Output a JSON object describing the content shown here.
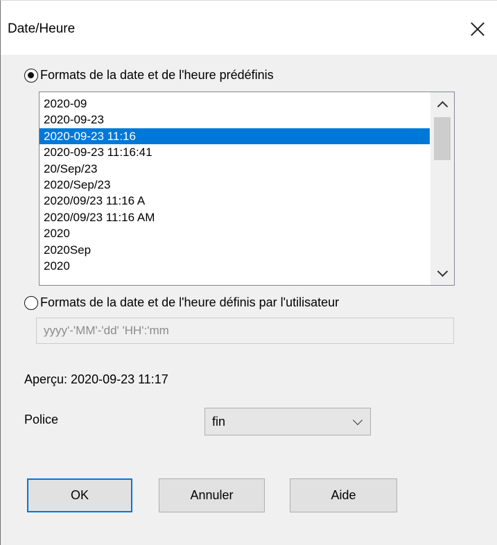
{
  "window": {
    "title": "Date/Heure",
    "close_icon": "close-icon"
  },
  "predefined": {
    "label": "Formats de la date et de l'heure prédéfinis",
    "checked": true,
    "items": [
      "2020-09",
      "2020-09-23",
      "2020-09-23 11:16",
      "2020-09-23 11:16:41",
      "20/Sep/23",
      "2020/Sep/23",
      "2020/09/23 11:16 A",
      "2020/09/23 11:16 AM",
      "2020",
      "2020Sep",
      "2020"
    ],
    "selected_index": 2
  },
  "custom": {
    "label": "Formats de la date et de l'heure définis par l'utilisateur",
    "checked": false,
    "value": "yyyy'-'MM'-'dd' 'HH':'mm"
  },
  "preview": {
    "text": "Aperçu: 2020-09-23 11:17"
  },
  "font": {
    "label": "Police",
    "selected": "fin"
  },
  "buttons": {
    "ok": "OK",
    "cancel": "Annuler",
    "help": "Aide"
  },
  "colors": {
    "selection": "#0078d7",
    "default_button_border": "#0078d7"
  }
}
